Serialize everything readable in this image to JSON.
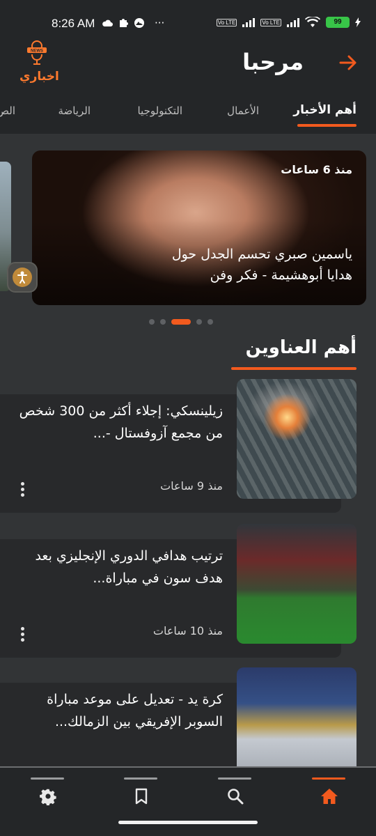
{
  "status_bar": {
    "time": "8:26 AM",
    "more": "···",
    "lte1": "Vo LTE",
    "lte2": "Vo LTE",
    "battery": "99"
  },
  "header": {
    "logo_text": "اخباري",
    "logo_badge": "NEWS",
    "greeting": "مرحبا"
  },
  "tabs": [
    {
      "label": "أهم الأخبار",
      "active": true
    },
    {
      "label": "الأعمال",
      "active": false
    },
    {
      "label": "التكنولوجيا",
      "active": false
    },
    {
      "label": "الرياضة",
      "active": false
    },
    {
      "label": "الص",
      "active": false
    }
  ],
  "carousel": {
    "time": "منذ 6 ساعات",
    "title": "ياسمين صبري تحسم الجدل حول هدايا أبوهشيمة - فكر وفن",
    "slide_count": 5,
    "active_index": 2
  },
  "section": {
    "title": "أهم العناوين"
  },
  "news": [
    {
      "title": "زيلينسكي: إجلاء أكثر من 300 شخص من مجمع آزوفستال -...",
      "time": "منذ 9 ساعات"
    },
    {
      "title": "ترتيب هدافي الدوري الإنجليزي بعد هدف سون في مباراة...",
      "time": "منذ 10 ساعات"
    },
    {
      "title": "كرة يد - تعديل على موعد مباراة السوبر الإفريقي بين الزمالك...",
      "time": ""
    }
  ],
  "bottom_nav": [
    {
      "name": "settings",
      "active": false
    },
    {
      "name": "bookmarks",
      "active": false
    },
    {
      "name": "search",
      "active": false
    },
    {
      "name": "home",
      "active": true
    }
  ],
  "colors": {
    "accent": "#f25a1e",
    "background": "#323436",
    "bar": "#242628"
  }
}
